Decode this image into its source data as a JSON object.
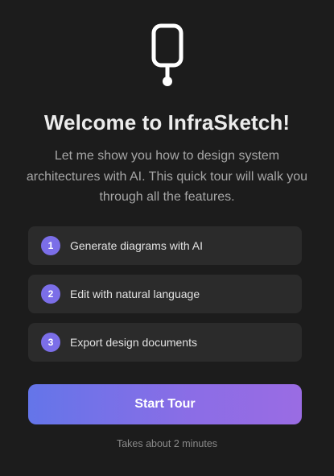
{
  "logo": {
    "icon": "probe-logo-icon",
    "color": "#ffffff"
  },
  "title": "Welcome to InfraSketch!",
  "subtitle": "Let me show you how to design system architectures with AI. This quick tour will walk you through all the features.",
  "features": [
    {
      "number": "1",
      "label": "Generate diagrams with AI"
    },
    {
      "number": "2",
      "label": "Edit with natural language"
    },
    {
      "number": "3",
      "label": "Export design documents"
    }
  ],
  "start_button": {
    "label": "Start Tour",
    "gradient": [
      "#6475e9",
      "#9a6ce3"
    ]
  },
  "note": "Takes about 2 minutes",
  "colors": {
    "background": "#1c1c1c",
    "card": "#2b2b2b",
    "accent": "#7b6ee8"
  }
}
